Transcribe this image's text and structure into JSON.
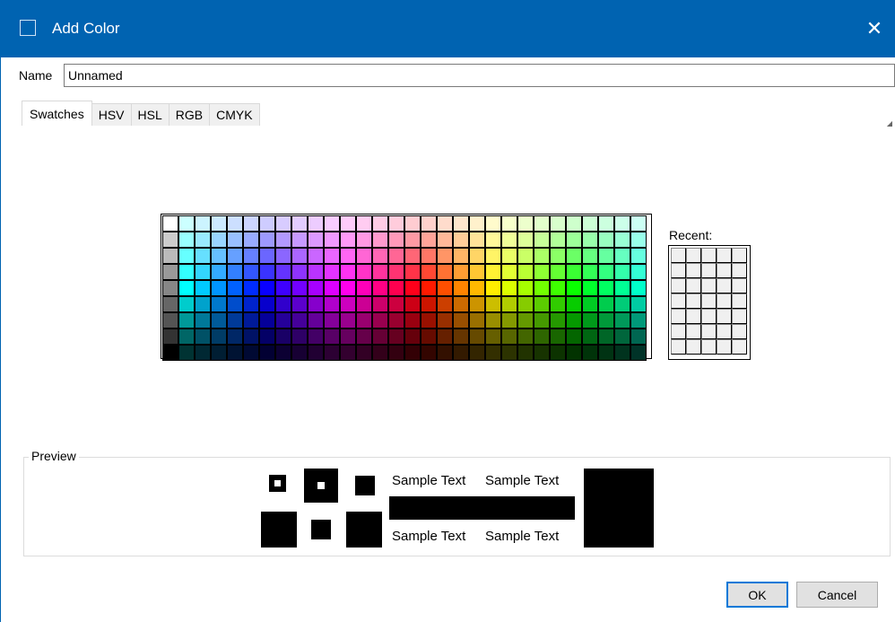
{
  "window": {
    "title": "Add Color",
    "close_glyph": "✕"
  },
  "name_field": {
    "label": "Name",
    "value": "Unnamed"
  },
  "tabs": [
    {
      "label": "Swatches",
      "active": true
    },
    {
      "label": "HSV",
      "active": false
    },
    {
      "label": "HSL",
      "active": false
    },
    {
      "label": "RGB",
      "active": false
    },
    {
      "label": "CMYK",
      "active": false
    }
  ],
  "recent": {
    "label": "Recent:"
  },
  "preview": {
    "label": "Preview",
    "sample_text_1": "Sample Text",
    "sample_text_2": "Sample Text",
    "sample_text_3": "Sample Text",
    "sample_text_4": "Sample Text",
    "color": "#000000"
  },
  "buttons": {
    "ok": "OK",
    "cancel": "Cancel"
  },
  "colors": {
    "titlebar": "#0063b1",
    "default_button_border": "#0078d7"
  }
}
